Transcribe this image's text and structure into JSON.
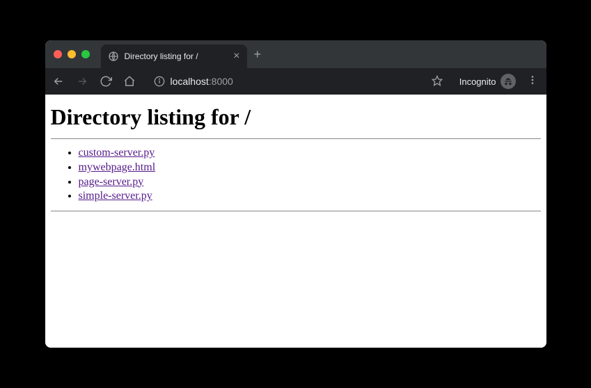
{
  "tab": {
    "title": "Directory listing for /"
  },
  "address": {
    "host": "localhost",
    "port": ":8000"
  },
  "incognito_label": "Incognito",
  "page": {
    "heading": "Directory listing for /",
    "files": [
      "custom-server.py",
      "mywebpage.html",
      "page-server.py",
      "simple-server.py"
    ]
  }
}
